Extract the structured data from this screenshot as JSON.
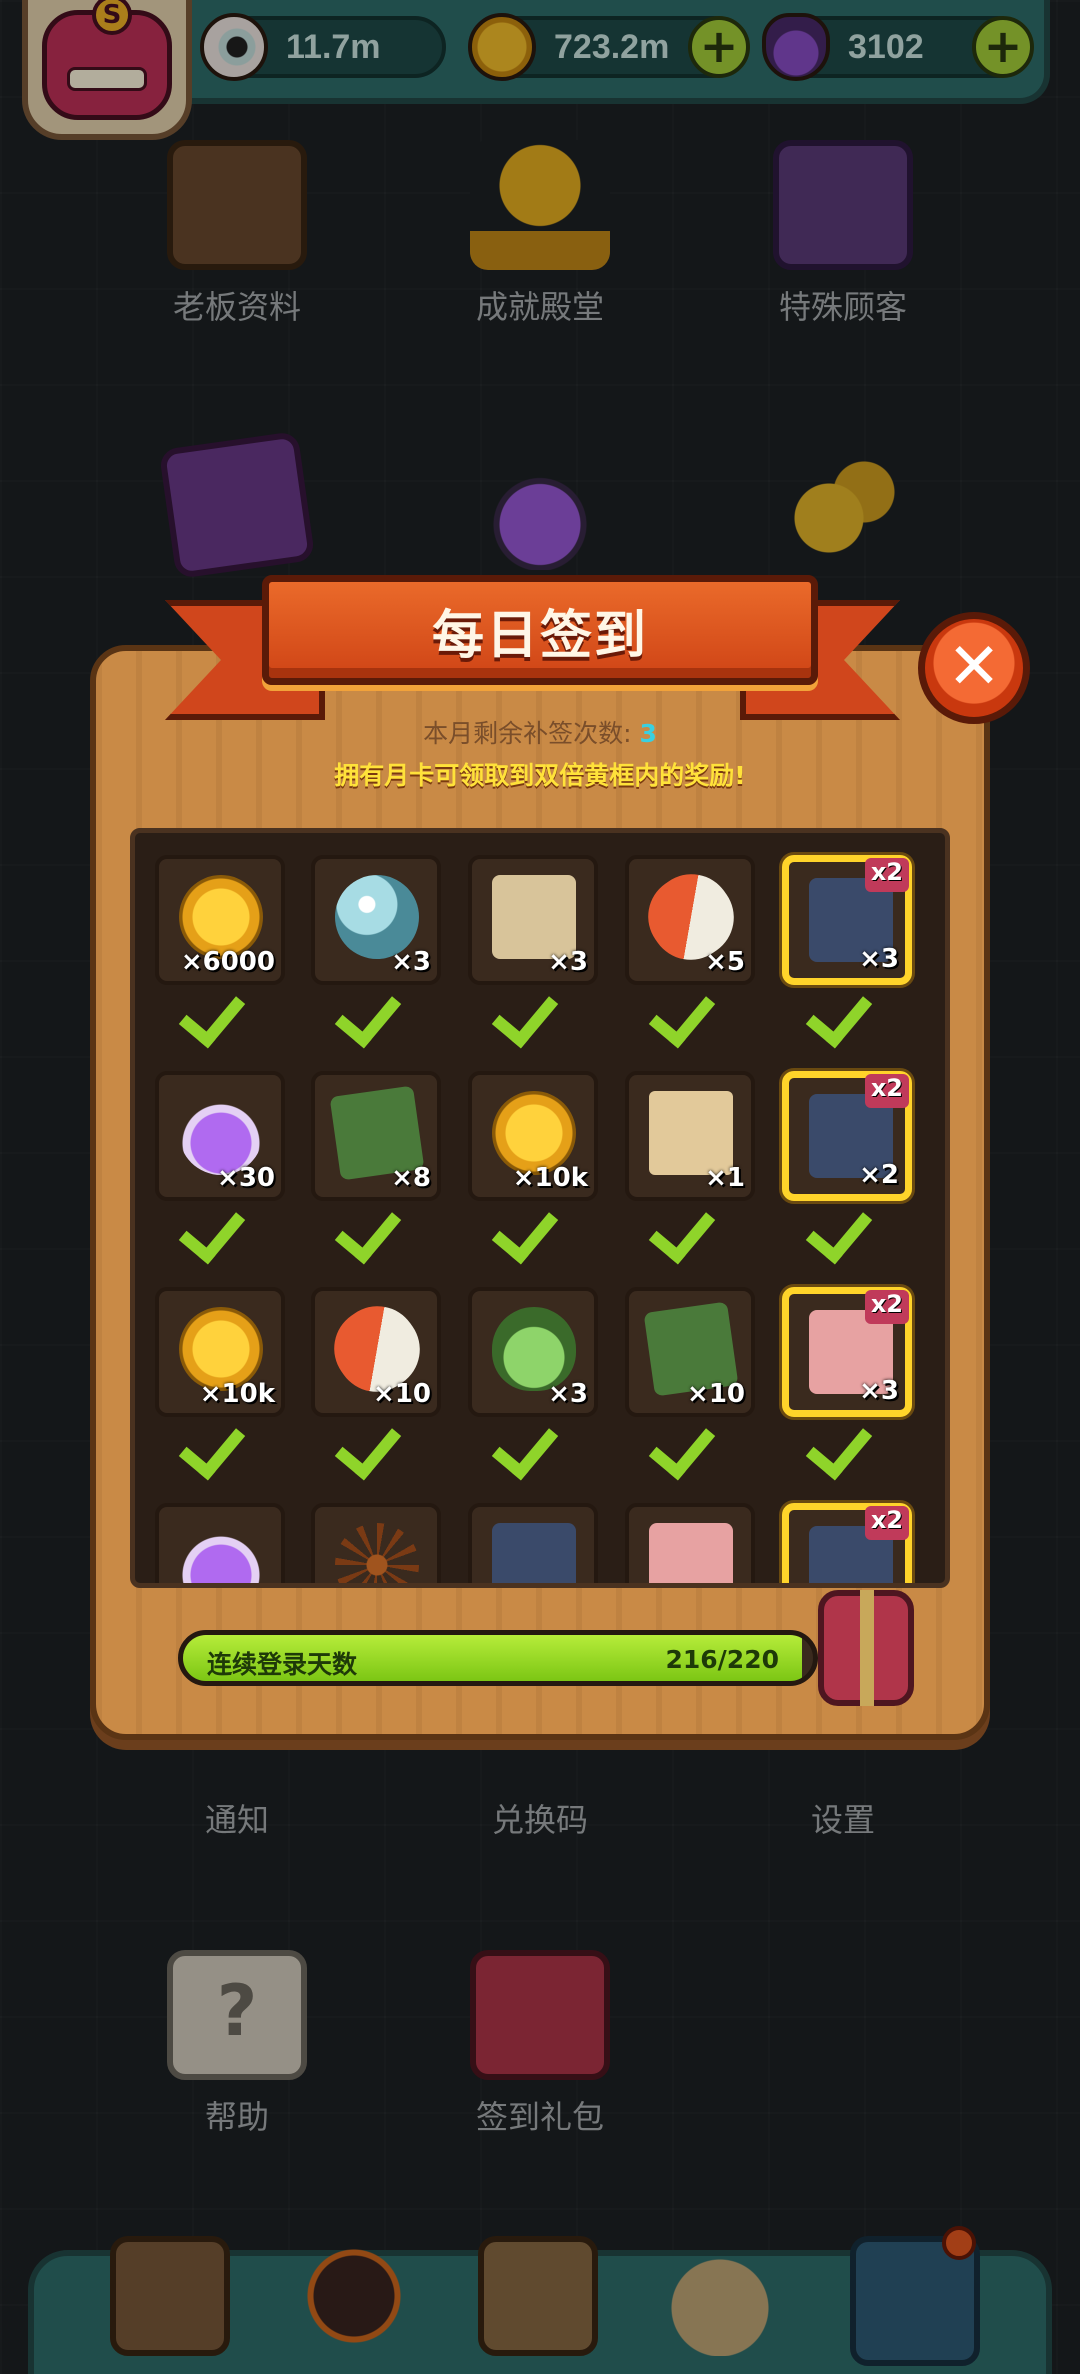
{
  "top_bar": {
    "eyes_value": "11.7m",
    "coins_value": "723.2m",
    "potions_value": "3102",
    "plus_symbol": "+"
  },
  "menu": {
    "boss_profile": "老板资料",
    "achievement_hall": "成就殿堂",
    "special_customers": "特殊顾客",
    "notice": "通知",
    "redeem_code": "兑换码",
    "settings": "设置",
    "help": "帮助",
    "sign_in_gift": "签到礼包"
  },
  "modal": {
    "title": "每日签到",
    "close_symbol": "✕",
    "remain_label": "本月剩余补签次数: ",
    "remain_count": "3",
    "monthly_card_tip": "拥有月卡可领取到双倍黄框内的奖励!",
    "double_badge": "x2",
    "rows": [
      [
        {
          "icon": "gold-coin-icon",
          "qty": "×6000",
          "claimed": true
        },
        {
          "icon": "pearl-icon",
          "qty": "×3",
          "claimed": true
        },
        {
          "icon": "treasure-map-icon",
          "qty": "×3",
          "claimed": true
        },
        {
          "icon": "capsule-icon",
          "qty": "×5",
          "claimed": true
        },
        {
          "icon": "monster-card-icon",
          "qty": "×3",
          "claimed": true,
          "double": true
        }
      ],
      [
        {
          "icon": "purple-potion-icon",
          "qty": "×30",
          "claimed": true
        },
        {
          "icon": "green-card-icon",
          "qty": "×8",
          "claimed": true
        },
        {
          "icon": "gold-coin-icon",
          "qty": "×10k",
          "claimed": true
        },
        {
          "icon": "ticket-icon",
          "qty": "×1",
          "claimed": true
        },
        {
          "icon": "monster-card-icon",
          "qty": "×2",
          "claimed": true,
          "double": true
        }
      ],
      [
        {
          "icon": "gold-coin-icon",
          "qty": "×10k",
          "claimed": true
        },
        {
          "icon": "capsule-icon",
          "qty": "×10",
          "claimed": true
        },
        {
          "icon": "green-egg-icon",
          "qty": "×3",
          "claimed": true
        },
        {
          "icon": "green-card-icon",
          "qty": "×10",
          "claimed": true
        },
        {
          "icon": "recipe-scroll-icon",
          "qty": "×3",
          "claimed": true,
          "double": true
        }
      ],
      [
        {
          "icon": "purple-potion-icon",
          "qty": "",
          "claimed": false
        },
        {
          "icon": "seed-icon",
          "qty": "",
          "claimed": false
        },
        {
          "icon": "monster-card-icon",
          "qty": "",
          "claimed": false
        },
        {
          "icon": "recipe-scroll-icon",
          "qty": "",
          "claimed": false
        },
        {
          "icon": "monster-card-icon",
          "qty": "",
          "claimed": false,
          "double": true
        }
      ]
    ],
    "streak_label": "连续登录天数",
    "streak_current": 216,
    "streak_total": 220,
    "streak_text": "216/220"
  },
  "colors": {
    "progress_green": "#8fd42a",
    "gold_frame": "#ffd42a",
    "ribbon_red": "#d0461c"
  }
}
